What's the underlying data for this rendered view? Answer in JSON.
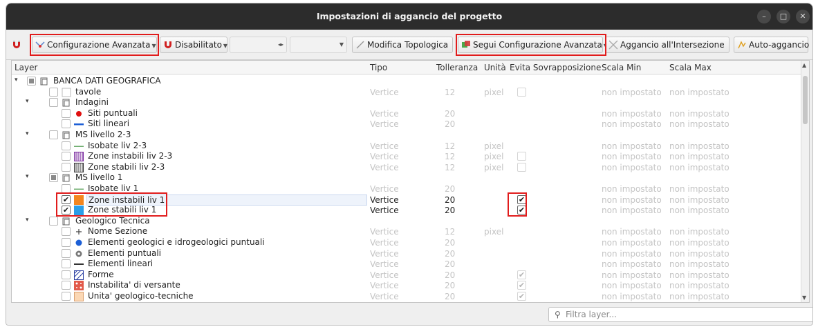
{
  "window": {
    "title": "Impostazioni di aggancio del progetto",
    "controls": [
      "–",
      "□",
      "✕"
    ]
  },
  "toolbar": {
    "advanced_config": "Configurazione Avanzata",
    "disabled": "Disabilitato",
    "topological_edit": "Modifica Topologica",
    "follow_advanced": "Segui Configurazione Avanzata",
    "intersection_snap": "Aggancio all'Intersezione",
    "self_snap": "Auto-aggancio"
  },
  "columns": [
    "Layer",
    "Tipo",
    "Tolleranza",
    "Unità",
    "Evita Sovrapposizione",
    "Scala Min",
    "Scala Max"
  ],
  "rows": [
    {
      "level": 0,
      "expand": "▾",
      "check": "part",
      "icon": "group-icon",
      "name": "BANCA DATI GEOGRAFICA",
      "tipo": "",
      "tol": "",
      "unit": "",
      "avoid": "",
      "min": "",
      "max": "",
      "active": false
    },
    {
      "level": 1,
      "expand": "",
      "check": "off",
      "icon": "blank-square-icon",
      "name": "tavole",
      "tipo": "Vertice",
      "tol": "12",
      "unit": "pixel",
      "avoid": "empty",
      "min": "non impostato",
      "max": "non impostato",
      "active": false
    },
    {
      "level": 1,
      "expand": "▾",
      "check": "off",
      "icon": "group-icon",
      "name": "Indagini",
      "tipo": "",
      "tol": "",
      "unit": "",
      "avoid": "",
      "min": "",
      "max": "",
      "active": false
    },
    {
      "level": 2,
      "expand": "",
      "check": "off",
      "icon": "red-point-icon",
      "name": "Siti puntuali",
      "tipo": "Vertice",
      "tol": "20",
      "unit": "",
      "avoid": "",
      "min": "non impostato",
      "max": "non impostato",
      "active": false
    },
    {
      "level": 2,
      "expand": "",
      "check": "off",
      "icon": "blue-line-icon",
      "name": "Siti lineari",
      "tipo": "Vertice",
      "tol": "20",
      "unit": "",
      "avoid": "",
      "min": "non impostato",
      "max": "non impostato",
      "active": false
    },
    {
      "level": 1,
      "expand": "▾",
      "check": "off",
      "icon": "group-icon",
      "name": "MS livello 2-3",
      "tipo": "",
      "tol": "",
      "unit": "",
      "avoid": "",
      "min": "",
      "max": "",
      "active": false
    },
    {
      "level": 2,
      "expand": "",
      "check": "off",
      "icon": "green-line-icon",
      "name": "Isobate liv 2-3",
      "tipo": "Vertice",
      "tol": "12",
      "unit": "pixel",
      "avoid": "",
      "min": "non impostato",
      "max": "non impostato",
      "active": false
    },
    {
      "level": 2,
      "expand": "",
      "check": "off",
      "icon": "purple-hatch-icon",
      "name": "Zone instabili liv 2-3",
      "tipo": "Vertice",
      "tol": "12",
      "unit": "pixel",
      "avoid": "empty",
      "min": "non impostato",
      "max": "non impostato",
      "active": false
    },
    {
      "level": 2,
      "expand": "",
      "check": "off",
      "icon": "green-hatch-icon",
      "name": "Zone stabili liv 2-3",
      "tipo": "Vertice",
      "tol": "12",
      "unit": "pixel",
      "avoid": "empty",
      "min": "non impostato",
      "max": "non impostato",
      "active": false
    },
    {
      "level": 1,
      "expand": "▾",
      "check": "part",
      "icon": "group-icon",
      "name": "MS livello 1",
      "tipo": "",
      "tol": "",
      "unit": "",
      "avoid": "",
      "min": "",
      "max": "",
      "active": false
    },
    {
      "level": 2,
      "expand": "",
      "check": "off",
      "icon": "green-line-icon",
      "name": "Isobate liv 1",
      "tipo": "Vertice",
      "tol": "20",
      "unit": "",
      "avoid": "",
      "min": "non impostato",
      "max": "non impostato",
      "active": false
    },
    {
      "level": 2,
      "expand": "",
      "check": "on",
      "icon": "orange-square-icon",
      "name": "Zone instabili liv 1",
      "tipo": "Vertice",
      "tol": "20",
      "unit": "",
      "avoid": "checked",
      "min": "non impostato",
      "max": "non impostato",
      "active": true,
      "selected": true
    },
    {
      "level": 2,
      "expand": "",
      "check": "on",
      "icon": "blue-square-icon",
      "name": "Zone stabili liv 1",
      "tipo": "Vertice",
      "tol": "20",
      "unit": "",
      "avoid": "checked",
      "min": "non impostato",
      "max": "non impostato",
      "active": true
    },
    {
      "level": 1,
      "expand": "▾",
      "check": "off",
      "icon": "group-icon",
      "name": "Geologico Tecnica",
      "tipo": "",
      "tol": "",
      "unit": "",
      "avoid": "",
      "min": "",
      "max": "",
      "active": false
    },
    {
      "level": 2,
      "expand": "",
      "check": "off",
      "icon": "plus-icon",
      "name": "Nome Sezione",
      "tipo": "Vertice",
      "tol": "12",
      "unit": "pixel",
      "avoid": "",
      "min": "non impostato",
      "max": "non impostato",
      "active": false
    },
    {
      "level": 2,
      "expand": "",
      "check": "off",
      "icon": "blue-point-icon",
      "name": "Elementi geologici e idrogeologici puntuali",
      "tipo": "Vertice",
      "tol": "20",
      "unit": "",
      "avoid": "",
      "min": "non impostato",
      "max": "non impostato",
      "active": false
    },
    {
      "level": 2,
      "expand": "",
      "check": "off",
      "icon": "gear-point-icon",
      "name": "Elementi puntuali",
      "tipo": "Vertice",
      "tol": "20",
      "unit": "",
      "avoid": "",
      "min": "non impostato",
      "max": "non impostato",
      "active": false
    },
    {
      "level": 2,
      "expand": "",
      "check": "off",
      "icon": "black-line-icon",
      "name": "Elementi lineari",
      "tipo": "Vertice",
      "tol": "20",
      "unit": "",
      "avoid": "",
      "min": "non impostato",
      "max": "non impostato",
      "active": false
    },
    {
      "level": 2,
      "expand": "",
      "check": "off",
      "icon": "blue-hatch-icon",
      "name": "Forme",
      "tipo": "Vertice",
      "tol": "20",
      "unit": "",
      "avoid": "grey-check",
      "min": "non impostato",
      "max": "non impostato",
      "active": false
    },
    {
      "level": 2,
      "expand": "",
      "check": "off",
      "icon": "red-pattern-icon",
      "name": "Instabilita' di versante",
      "tipo": "Vertice",
      "tol": "20",
      "unit": "",
      "avoid": "grey-check",
      "min": "non impostato",
      "max": "non impostato",
      "active": false
    },
    {
      "level": 2,
      "expand": "",
      "check": "off",
      "icon": "peach-square-icon",
      "name": "Unita' geologico-tecniche",
      "tipo": "Vertice",
      "tol": "20",
      "unit": "",
      "avoid": "grey-check",
      "min": "non impostato",
      "max": "non impostato",
      "active": false
    }
  ],
  "filter": {
    "placeholder": "Filtra layer..."
  },
  "colors": {
    "highlight": "#e11c1c",
    "titlebar": "#2c2c2c"
  }
}
